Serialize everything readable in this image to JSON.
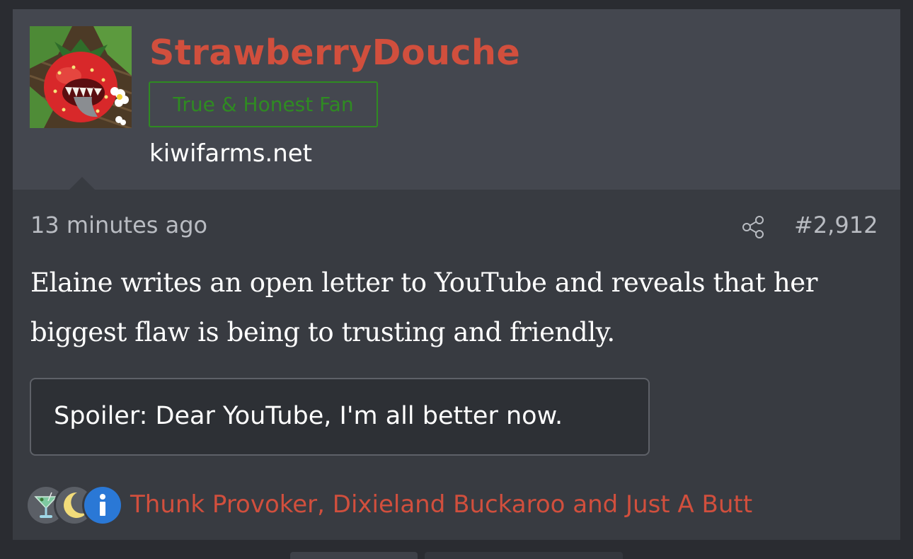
{
  "post": {
    "author": {
      "username": "StrawberryDouche",
      "user_title": "True & Honest Fan",
      "site": "kiwifarms.net",
      "avatar_icon": "strawberry-monster-avatar"
    },
    "time_ago": "13 minutes ago",
    "share_icon": "share-icon",
    "post_number": "#2,912",
    "message": "Elaine writes an open letter to YouTube and reveals that her biggest flaw is being to trusting and friendly.",
    "spoiler_label": "Spoiler: Dear YouTube, I'm all better now.",
    "reactions": {
      "icons": [
        "cocktail-icon",
        "moon-icon",
        "info-icon"
      ],
      "reacted_by": "Thunk Provoker, Dixieland Buckaroo and Just A Butt"
    }
  },
  "colors": {
    "username": "#d14f3d",
    "user_title": "#2f8b22",
    "header_bg": "#44474f",
    "body_bg": "#383b41"
  }
}
